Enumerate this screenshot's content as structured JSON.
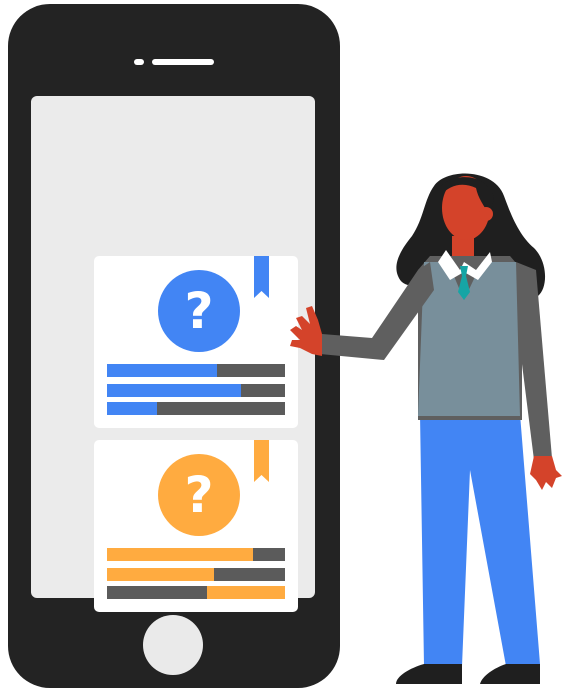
{
  "colors": {
    "phone_body": "#232323",
    "screen": "#ebebeb",
    "card": "#ffffff",
    "track": "#5b5b5b",
    "accent_blue": "#4285f4",
    "accent_orange": "#ffab40",
    "skin": "#d4432a",
    "hair": "#1f1f1f",
    "vest": "#788f9b",
    "sleeve": "#5f5f5f",
    "pants": "#4285f4",
    "tie": "#16a5a5"
  },
  "cards": [
    {
      "accent": "#4285f4",
      "icon": "question-mark-icon",
      "question_mark": "?",
      "bars": [
        {
          "fill_fraction": 0.62,
          "side": "left"
        },
        {
          "fill_fraction": 0.75,
          "side": "left"
        },
        {
          "fill_fraction": 0.28,
          "side": "left"
        }
      ]
    },
    {
      "accent": "#ffab40",
      "icon": "question-mark-icon",
      "question_mark": "?",
      "bars": [
        {
          "fill_fraction": 0.82,
          "side": "left"
        },
        {
          "fill_fraction": 0.6,
          "side": "left"
        },
        {
          "fill_fraction": 0.44,
          "side": "right"
        }
      ]
    }
  ]
}
